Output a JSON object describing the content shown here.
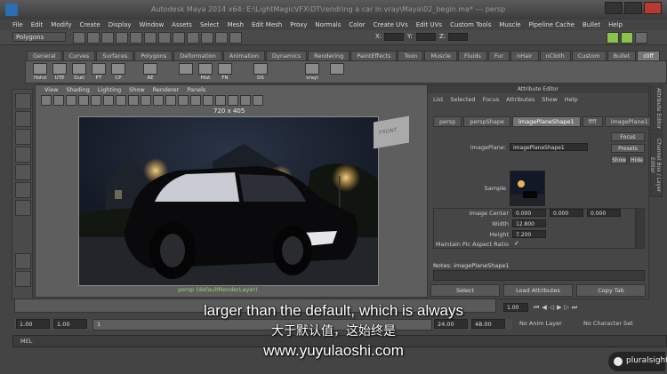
{
  "window": {
    "title": "Autodesk Maya 2014 x64: E:\\LightMagicVFX\\DT\\rendring a car in vray\\Maya\\02_begin.ma* --- persp"
  },
  "menubar": [
    "File",
    "Edit",
    "Modify",
    "Create",
    "Display",
    "Window",
    "Assets",
    "Select",
    "Mesh",
    "Edit Mesh",
    "Proxy",
    "Normals",
    "Color",
    "Create UVs",
    "Edit UVs",
    "Custom Tools",
    "Muscle",
    "Pipeline Cache",
    "Bullet",
    "Help"
  ],
  "status_line": {
    "mode": "Polygons",
    "x_label": "X:",
    "y_label": "Y:",
    "z_label": "Z:"
  },
  "shelf": {
    "tabs": [
      "General",
      "Curves",
      "Surfaces",
      "Polygons",
      "Deformation",
      "Animation",
      "Dynamics",
      "Rendering",
      "PaintEffects",
      "Toon",
      "Muscle",
      "Fluids",
      "Fur",
      "nHair",
      "nCloth",
      "Custom",
      "Bullet",
      "cliff"
    ],
    "active_tab": "cliff",
    "items": [
      "Hshd",
      "UTE",
      "Outl",
      "FT",
      "CP",
      "AE",
      "",
      "Hist",
      "FN",
      "DS",
      "vrayl",
      ""
    ]
  },
  "viewport": {
    "menu": [
      "View",
      "Shading",
      "Lighting",
      "Show",
      "Renderer",
      "Panels"
    ],
    "resolution": "720 x 405",
    "camera_label": "persp (defaultRenderLayer)",
    "viewcube_label": "FRONT"
  },
  "attribute_editor": {
    "title": "Attribute Editor",
    "menu": [
      "List",
      "Selected",
      "Focus",
      "Attributes",
      "Show",
      "Help"
    ],
    "tabs": [
      "persp",
      "perspShape",
      "imagePlaneShape1",
      "ffff",
      "imagePlane1"
    ],
    "active_tab": "imagePlaneShape1",
    "image_plane_label": "imagePlane:",
    "image_plane_value": "imagePlaneShape1",
    "focus_btn": "Focus",
    "presets_btn": "Presets",
    "show_btn": "Show",
    "hide_btn": "Hide",
    "sample_label": "Sample",
    "image_center_label": "Image Center",
    "image_center": [
      "0.000",
      "0.000",
      "0.000"
    ],
    "width_label": "Width",
    "width_value": "12.800",
    "height_label": "Height",
    "height_value": "7.200",
    "aspect_label": "Maintain Pic Aspect Ratio",
    "aspect_check": "✓",
    "notes_label": "Notes: imagePlaneShape1",
    "buttons": [
      "Select",
      "Load Attributes",
      "Copy Tab"
    ],
    "side_tabs": [
      "Attribute Editor",
      "Channel Box / Layer Editor"
    ]
  },
  "timeline": {
    "current_frame": "1.00",
    "range_start": "1.00",
    "range_inner_start": "1.00",
    "range_inner_marker": "1",
    "range_end": "24.00",
    "range_max": "48.00",
    "anim_layer": "No Anim Layer",
    "character_set": "No Character Set"
  },
  "command_line": {
    "label": "MEL"
  },
  "subtitles": {
    "english": "larger than the default, which is always",
    "chinese": "大于默认值，这始终是",
    "url": "www.yuyulaoshi.com"
  },
  "brand": {
    "name": "pluralsight"
  },
  "colors": {
    "accent_green": "#9ad46a",
    "maya_blue": "#2a6fb4",
    "close_red": "#b93a32"
  }
}
